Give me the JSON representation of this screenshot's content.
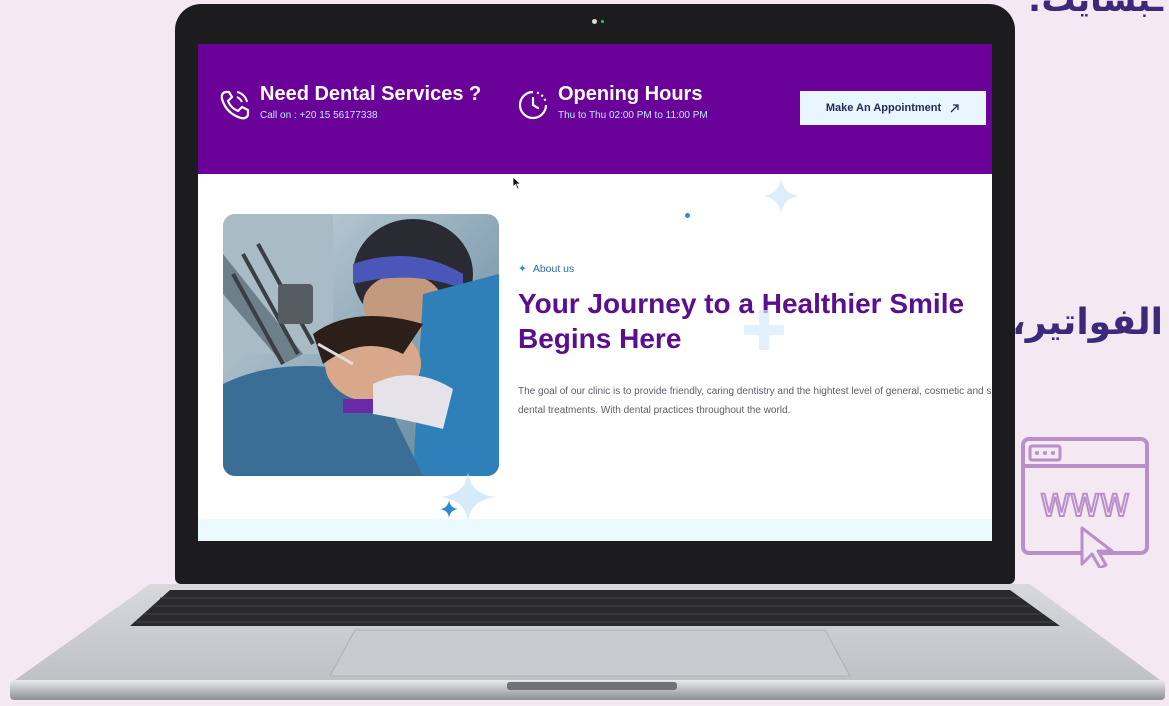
{
  "background": {
    "arabic_top": "ـبسايت:",
    "arabic_mid": "الفواتير،",
    "www_label": "WWW",
    "colors": {
      "accent": "#6a0199",
      "heading": "#5a0f8f",
      "bg": "#f4e9f2"
    }
  },
  "topbar": {
    "services": {
      "title": "Need Dental Services ?",
      "subtitle": "Call on : +20 15 56177338",
      "icon": "phone-icon"
    },
    "hours": {
      "title": "Opening Hours",
      "subtitle": "Thu to Thu 02:00 PM to 11:00 PM",
      "icon": "clock-icon"
    },
    "appointment_label": "Make An Appointment",
    "appointment_icon": "arrow-up-right-icon"
  },
  "about": {
    "tag": "About us",
    "heading_line1": "Your Journey to a Healthier Smile",
    "heading_line2": "Begins Here",
    "paragraph": "The goal of our clinic is to provide friendly, caring dentistry and the hightest level of general, cosmetic and specialist dental treatments. With dental practices throughout the world."
  }
}
